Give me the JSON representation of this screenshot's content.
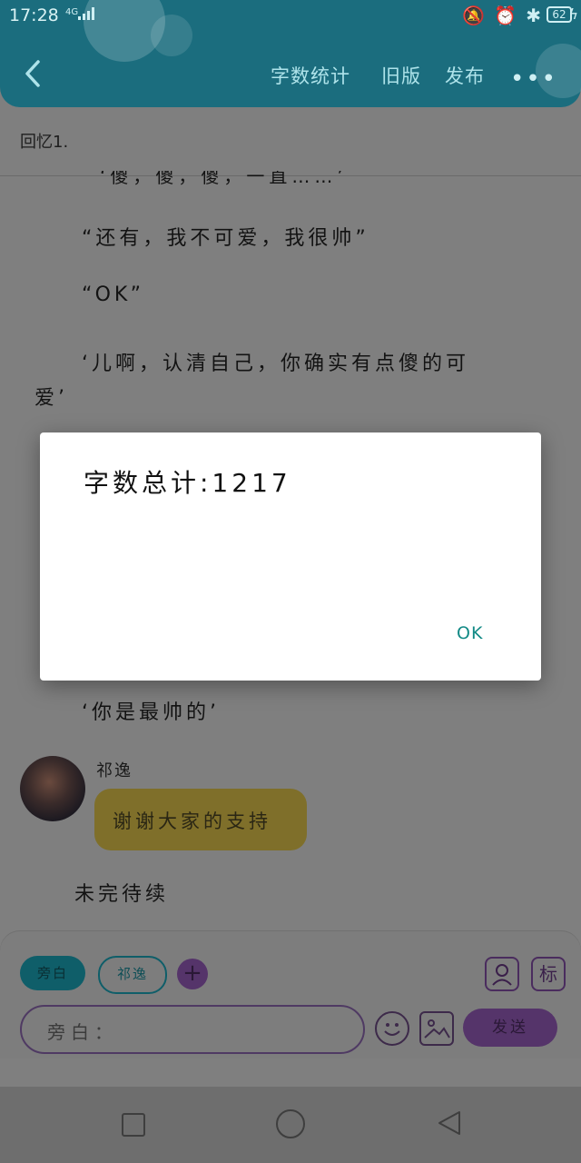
{
  "status_bar": {
    "time": "17:28",
    "network": "4G",
    "battery": "62"
  },
  "header": {
    "actions": [
      "字数统计",
      "旧版",
      "发布"
    ],
    "more": "•••"
  },
  "chapter_title": "回忆1.",
  "story": {
    "partial_line": "‘傻，傻，傻，一直……’",
    "lines": [
      "“还有，我不可爱，我很帅”",
      "“OK”",
      "‘儿啊，认清自己，你确实有点傻的可",
      "爱’",
      "‘你是最帅的’"
    ],
    "speaker_name": "祁逸",
    "speech_text": "谢谢大家的支持",
    "to_be_continued": "未完待续"
  },
  "input_panel": {
    "chip_narration": "旁白",
    "chip_character": "祁逸",
    "add_label": "+",
    "biao_label": "标",
    "placeholder": "旁白：",
    "send_label": "发送"
  },
  "dialog": {
    "text": "字数总计:1217",
    "ok_label": "OK"
  },
  "colors": {
    "header": "#1b6d7e",
    "accent_purple": "#55346a",
    "accent_teal": "#138a86",
    "speech_bubble": "#7f6f2a"
  }
}
